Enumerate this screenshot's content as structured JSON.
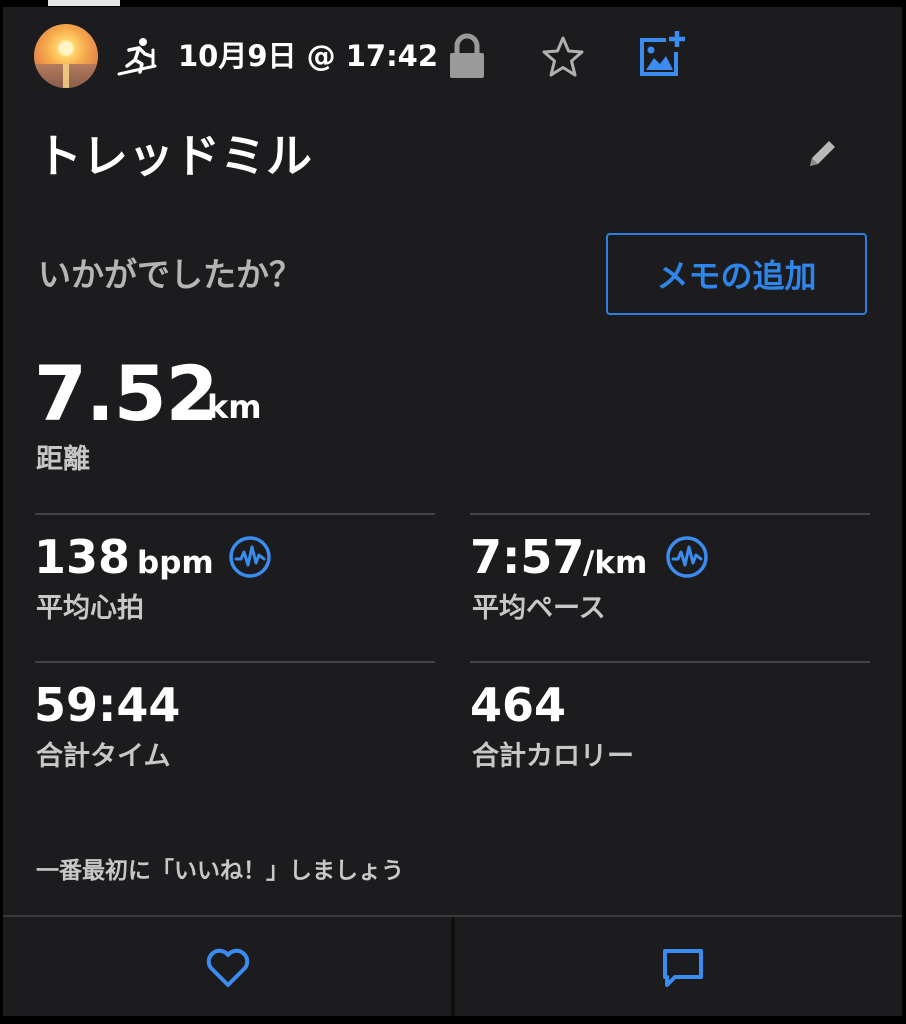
{
  "header": {
    "date_time": "10月9日 @ 17:42",
    "icons": [
      "treadmill-icon",
      "lock-icon",
      "star-icon",
      "add-photo-icon"
    ]
  },
  "activity": {
    "title": "トレッドミル",
    "edit_icon": "pencil-icon"
  },
  "feeling": {
    "prompt": "いかがでしたか？",
    "memo_button_label": "メモの追加"
  },
  "distance": {
    "value": "7.52",
    "unit": "km",
    "label": "距離"
  },
  "stats": {
    "heart_rate": {
      "value": "138",
      "unit": "bpm",
      "label": "平均心拍"
    },
    "pace": {
      "value": "7:57",
      "unit": "/km",
      "label": "平均ペース"
    },
    "time": {
      "value": "59:44",
      "label": "合計タイム"
    },
    "calories": {
      "value": "464",
      "label": "合計カロリー"
    }
  },
  "social": {
    "like_prompt": "一番最初に「いいね！」しましょう"
  },
  "colors": {
    "background": "#1c1c1e",
    "accent_blue": "#2f86ea",
    "muted_text": "#c8c8c8",
    "divider": "#444446"
  }
}
